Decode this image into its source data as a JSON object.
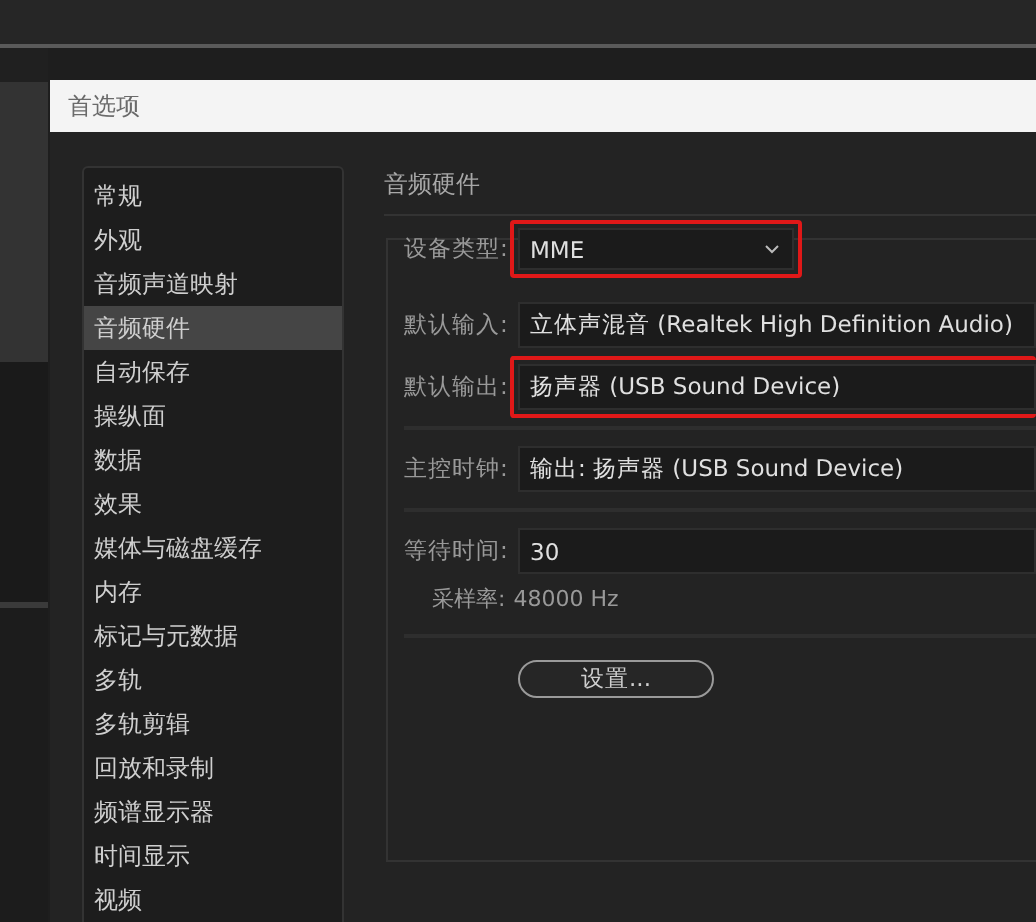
{
  "dialog": {
    "title": "首选项"
  },
  "sidebar": {
    "items": [
      {
        "label": "常规",
        "selected": false
      },
      {
        "label": "外观",
        "selected": false
      },
      {
        "label": "音频声道映射",
        "selected": false
      },
      {
        "label": "音频硬件",
        "selected": true
      },
      {
        "label": "自动保存",
        "selected": false
      },
      {
        "label": "操纵面",
        "selected": false
      },
      {
        "label": "数据",
        "selected": false
      },
      {
        "label": "效果",
        "selected": false
      },
      {
        "label": "媒体与磁盘缓存",
        "selected": false
      },
      {
        "label": "内存",
        "selected": false
      },
      {
        "label": "标记与元数据",
        "selected": false
      },
      {
        "label": "多轨",
        "selected": false
      },
      {
        "label": "多轨剪辑",
        "selected": false
      },
      {
        "label": "回放和录制",
        "selected": false
      },
      {
        "label": "频谱显示器",
        "selected": false
      },
      {
        "label": "时间显示",
        "selected": false
      },
      {
        "label": "视频",
        "selected": false
      }
    ]
  },
  "panel": {
    "heading": "音频硬件",
    "device_type": {
      "label": "设备类型:",
      "value": "MME",
      "highlighted": true
    },
    "rows": [
      {
        "label": "默认输入:",
        "value": "立体声混音 (Realtek High Definition Audio)",
        "highlighted": false
      },
      {
        "label": "默认输出:",
        "value": "扬声器 (USB Sound Device)",
        "highlighted": true
      }
    ],
    "master_clock": {
      "label": "主控时钟:",
      "value": "输出: 扬声器 (USB Sound Device)"
    },
    "latency": {
      "label": "等待时间:",
      "value": "30"
    },
    "sample_rate": {
      "label": "采样率:",
      "value": "48000 Hz"
    },
    "settings_button": "设置..."
  }
}
